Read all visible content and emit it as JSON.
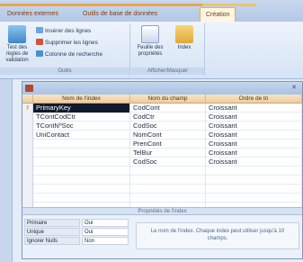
{
  "ribbon": {
    "tabs": [
      {
        "label": "Données externes"
      },
      {
        "label": "Outils de base de données"
      },
      {
        "label": "Création"
      }
    ],
    "groups": {
      "outils": {
        "label": "Outils",
        "regle_label": "Test des règles de validation",
        "insert_rows": "Insérer des lignes",
        "delete_rows": "Supprimer les lignes",
        "lookup_col": "Colonne de recherche"
      },
      "afficher": {
        "label": "Afficher/Masquer",
        "sheet_label": "Feuille des propriétés",
        "index_label": "Index"
      }
    }
  },
  "grid": {
    "headers": [
      "Nom de l'index",
      "Nom du champ",
      "Ordre de tri"
    ],
    "rows": [
      {
        "marker": "⚷",
        "index": "PrimaryKey",
        "field": "CodCont",
        "order": "Croissant"
      },
      {
        "marker": "",
        "index": "TContCodCtr",
        "field": "CodCtr",
        "order": "Croissant"
      },
      {
        "marker": "",
        "index": "TContNºSoc",
        "field": "CodSoc",
        "order": "Croissant"
      },
      {
        "marker": "",
        "index": "UniContact",
        "field": "NomCont",
        "order": "Croissant"
      },
      {
        "marker": "",
        "index": "",
        "field": "PrenCont",
        "order": "Croissant"
      },
      {
        "marker": "",
        "index": "",
        "field": "TelBur",
        "order": "Croissant"
      },
      {
        "marker": "",
        "index": "",
        "field": "CodSoc",
        "order": "Croissant"
      },
      {
        "marker": "",
        "index": "",
        "field": "",
        "order": ""
      },
      {
        "marker": "",
        "index": "",
        "field": "",
        "order": ""
      },
      {
        "marker": "",
        "index": "",
        "field": "",
        "order": ""
      },
      {
        "marker": "",
        "index": "",
        "field": "",
        "order": ""
      },
      {
        "marker": "",
        "index": "",
        "field": "",
        "order": ""
      }
    ]
  },
  "properties": {
    "section_title": "Propriétés de l'index",
    "rows": [
      {
        "label": "Primaire",
        "value": "Oui"
      },
      {
        "label": "Unique",
        "value": "Oui"
      },
      {
        "label": "Ignorer Nulls",
        "value": "Non"
      }
    ],
    "help": "Le nom de l'index. Chaque index peut utiliser jusqu'à 10 champs."
  },
  "colors": {
    "accent": "#e8b04a",
    "selection": "#0f1b2d"
  }
}
